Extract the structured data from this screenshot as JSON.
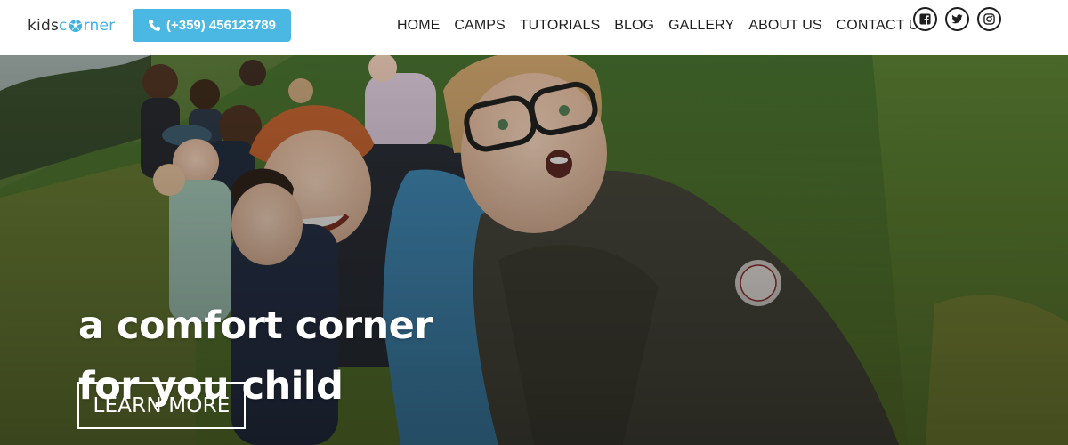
{
  "brand": {
    "logo_prefix": "kids",
    "logo_mid": "c",
    "logo_suffix": "rner",
    "accent_color": "#3fb2e3",
    "logo_icon": "soccer-ball-icon"
  },
  "header": {
    "phone_label": "(+359) 456123789",
    "phone_icon": "phone-icon",
    "phone_button_color": "#4bb8e4"
  },
  "nav": {
    "items": [
      {
        "label": "HOME"
      },
      {
        "label": "CAMPS"
      },
      {
        "label": "TUTORIALS"
      },
      {
        "label": "BLOG"
      },
      {
        "label": "GALLERY"
      },
      {
        "label": "ABOUT US"
      },
      {
        "label": "CONTACT US"
      }
    ]
  },
  "socials": [
    {
      "icon": "facebook-icon"
    },
    {
      "icon": "twitter-icon"
    },
    {
      "icon": "instagram-icon"
    }
  ],
  "hero": {
    "title_line_1": "a comfort corner",
    "title_line_2": "for you child",
    "cta_label": "LEARN MORE",
    "image_description_icon": "hero-photo"
  }
}
